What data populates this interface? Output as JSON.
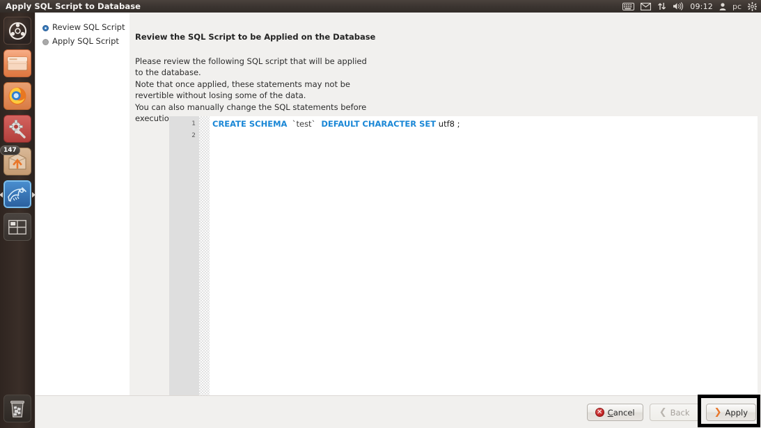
{
  "window": {
    "title": "Apply SQL Script to Database"
  },
  "top_panel": {
    "indicators": [
      {
        "name": "keyboard-icon",
        "glyph": "⌨"
      },
      {
        "name": "mail-icon",
        "glyph": "✉"
      },
      {
        "name": "network-icon",
        "glyph": "⇅"
      },
      {
        "name": "volume-icon",
        "glyph": "🔊"
      }
    ],
    "clock": "09:12",
    "user": "pc",
    "session_icon": "⚙"
  },
  "launcher": {
    "items": [
      {
        "name": "ubuntu-dash-icon",
        "label": "Ubuntu Dash",
        "glyph": "●"
      },
      {
        "name": "files-icon",
        "label": "Files",
        "glyph": ""
      },
      {
        "name": "firefox-icon",
        "label": "Firefox Web Browser",
        "glyph": ""
      },
      {
        "name": "system-settings-icon",
        "label": "System Settings",
        "glyph": ""
      },
      {
        "name": "software-updater-icon",
        "label": "Software Updater",
        "glyph": "",
        "badge": "147"
      },
      {
        "name": "mysql-workbench-icon",
        "label": "MySQL Workbench",
        "glyph": "",
        "active": true
      },
      {
        "name": "workspace-switcher-icon",
        "label": "Workspace Switcher",
        "glyph": ""
      }
    ],
    "trash": {
      "name": "trash-icon",
      "label": "Trash"
    }
  },
  "sidebar": {
    "steps": [
      {
        "label": "Review SQL Script",
        "state": "active"
      },
      {
        "label": "Apply SQL Script",
        "state": "pending"
      }
    ]
  },
  "main": {
    "heading": "Review the SQL Script to be Applied on the Database",
    "description_lines": [
      "Please review the following SQL script that will be applied",
      "to the database.",
      "Note that once applied, these statements may not be",
      "revertible without losing some of the data.",
      "You can also manually change the SQL statements before",
      "execution."
    ],
    "editor": {
      "line_numbers": [
        "1",
        "2"
      ],
      "lines": [
        {
          "tokens": [
            {
              "text": "CREATE SCHEMA",
              "type": "keyword"
            },
            {
              "text": "  `test`",
              "type": "identifier"
            },
            {
              "text": "  DEFAULT CHARACTER SET",
              "type": "keyword"
            },
            {
              "text": " utf8 ;",
              "type": "value"
            }
          ],
          "current": true
        },
        {
          "tokens": [],
          "current": false
        }
      ],
      "plain_text": "CREATE SCHEMA  `test`  DEFAULT CHARACTER SET utf8 ;"
    }
  },
  "footer": {
    "buttons": [
      {
        "name": "cancel-button",
        "label_pre": "",
        "label_accel": "C",
        "label_post": "ancel",
        "state": "enabled",
        "icon": "error-circle-icon"
      },
      {
        "name": "back-button",
        "label": "Back",
        "state": "disabled",
        "icon": "chevron-left-icon"
      },
      {
        "name": "apply-button",
        "label": "Apply",
        "state": "enabled",
        "icon": "chevron-right-icon",
        "highlighted": true
      }
    ]
  },
  "colors": {
    "panel_bg": "#33302c",
    "dialog_bg": "#f1f0ee",
    "accent_orange": "#e8643a",
    "keyword_blue": "#1a87d6",
    "current_line": "#e8f4fb",
    "annotation": "#000000"
  }
}
